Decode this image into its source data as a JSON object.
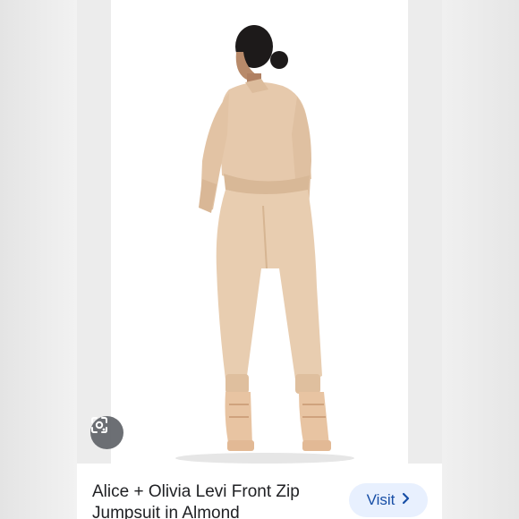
{
  "product": {
    "title": "Alice + Olivia Levi Front Zip Jumpsuit in Almond",
    "visit_label": "Visit"
  },
  "icons": {
    "lens": "google-lens-icon",
    "chevron": "chevron-right-icon"
  },
  "colors": {
    "visit_bg": "#e8f0fe",
    "visit_text": "#174ea6",
    "lens_bg": "#5f6368"
  }
}
